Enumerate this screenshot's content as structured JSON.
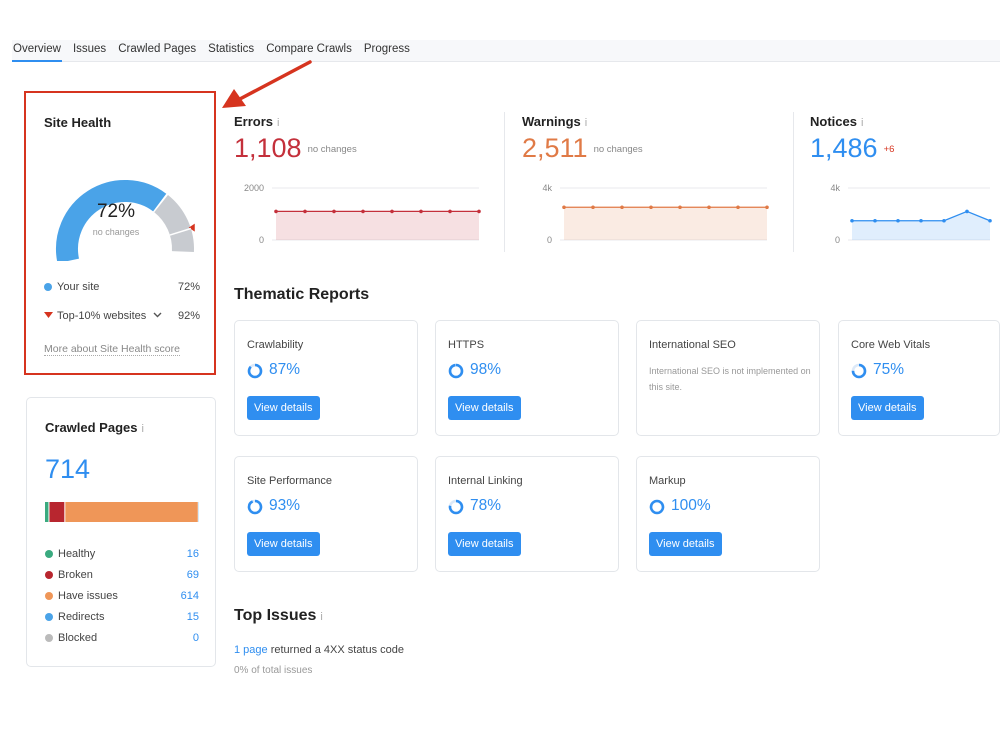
{
  "tabs": [
    "Overview",
    "Issues",
    "Crawled Pages",
    "Statistics",
    "Compare Crawls",
    "Progress"
  ],
  "site_health": {
    "title": "Site Health",
    "percent": "72%",
    "percent_value": 72,
    "change": "no changes",
    "your_site_label": "Your site",
    "your_site_value": "72%",
    "top10_label": "Top-10% websites",
    "top10_value": "92%",
    "top10_percent_value": 92,
    "more_link": "More about Site Health score"
  },
  "metrics": {
    "errors": {
      "label": "Errors",
      "value": "1,108",
      "change": "no changes",
      "ymax": "2000",
      "ymin": "0",
      "color": "#c4303b"
    },
    "warnings": {
      "label": "Warnings",
      "value": "2,511",
      "change": "no changes",
      "ymax": "4k",
      "ymin": "0",
      "color": "#e07a46"
    },
    "notices": {
      "label": "Notices",
      "value": "1,486",
      "change": "+6",
      "ymax": "4k",
      "ymin": "0",
      "color": "#2f8ef0"
    }
  },
  "thematic": {
    "title": "Thematic Reports",
    "view_label": "View details",
    "reports": [
      {
        "name": "Crawlability",
        "percent": "87%",
        "value": 87
      },
      {
        "name": "HTTPS",
        "percent": "98%",
        "value": 98
      },
      {
        "name": "International SEO",
        "note": "International SEO is not implemented on this site."
      },
      {
        "name": "Core Web Vitals",
        "percent": "75%",
        "value": 75
      },
      {
        "name": "Site Performance",
        "percent": "93%",
        "value": 93
      },
      {
        "name": "Internal Linking",
        "percent": "78%",
        "value": 78
      },
      {
        "name": "Markup",
        "percent": "100%",
        "value": 100
      }
    ]
  },
  "crawled": {
    "title": "Crawled Pages",
    "total": "714",
    "items": [
      {
        "label": "Healthy",
        "value": "16",
        "color": "#3aaa7f"
      },
      {
        "label": "Broken",
        "value": "69",
        "color": "#b8262f"
      },
      {
        "label": "Have issues",
        "value": "614",
        "color": "#ef9658"
      },
      {
        "label": "Redirects",
        "value": "15",
        "color": "#4aa3e8"
      },
      {
        "label": "Blocked",
        "value": "0",
        "color": "#bbbbbb"
      }
    ]
  },
  "top_issues": {
    "title": "Top Issues",
    "link": "1 page",
    "text": " returned a 4XX status code",
    "sub": "0% of total issues"
  },
  "colors": {
    "accent": "#2f8ef0",
    "highlight": "#d6341f",
    "gauge_gray": "#c8cbd0"
  }
}
